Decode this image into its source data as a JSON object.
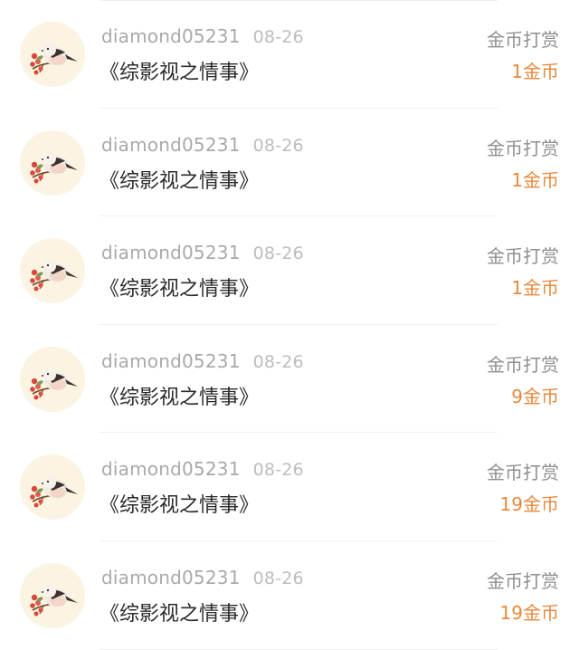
{
  "rows": [
    {
      "username": "diamond05231",
      "date": "08-26",
      "title": "《综影视之情事》",
      "type": "金币打赏",
      "amount": "1金币",
      "avatar_icon": "bird-avatar-icon"
    },
    {
      "username": "diamond05231",
      "date": "08-26",
      "title": "《综影视之情事》",
      "type": "金币打赏",
      "amount": "1金币",
      "avatar_icon": "bird-avatar-icon"
    },
    {
      "username": "diamond05231",
      "date": "08-26",
      "title": "《综影视之情事》",
      "type": "金币打赏",
      "amount": "1金币",
      "avatar_icon": "bird-avatar-icon"
    },
    {
      "username": "diamond05231",
      "date": "08-26",
      "title": "《综影视之情事》",
      "type": "金币打赏",
      "amount": "9金币",
      "avatar_icon": "bird-avatar-icon"
    },
    {
      "username": "diamond05231",
      "date": "08-26",
      "title": "《综影视之情事》",
      "type": "金币打赏",
      "amount": "19金币",
      "avatar_icon": "bird-avatar-icon"
    },
    {
      "username": "diamond05231",
      "date": "08-26",
      "title": "《综影视之情事》",
      "type": "金币打赏",
      "amount": "19金币",
      "avatar_icon": "bird-avatar-icon"
    }
  ],
  "colors": {
    "amount": "#e8893c",
    "username": "#a9a9a9",
    "title": "#2b2b2b",
    "avatar_bg": "#fbf4e3"
  }
}
